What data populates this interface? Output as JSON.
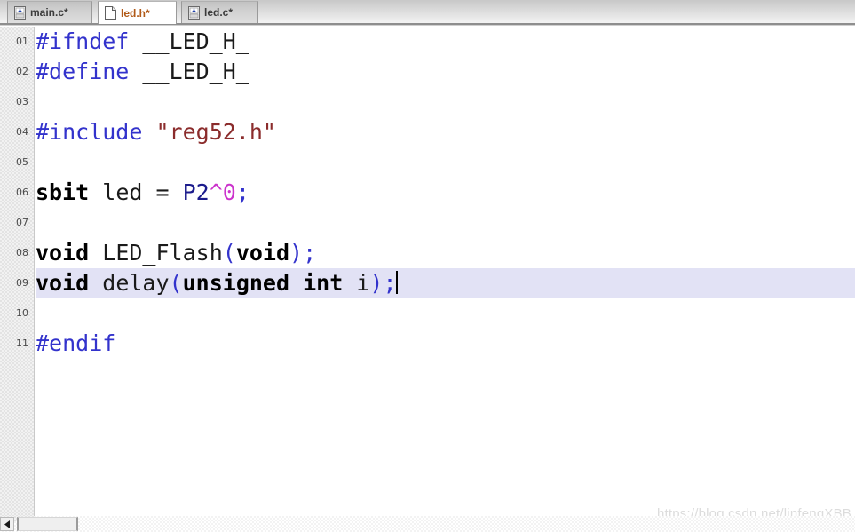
{
  "tabs": [
    {
      "label": "main.c*",
      "icon": "c-source-file-icon",
      "active": false
    },
    {
      "label": "led.h*",
      "icon": "header-file-icon",
      "active": true
    },
    {
      "label": "led.c*",
      "icon": "c-source-file-icon",
      "active": false
    }
  ],
  "editor": {
    "active_file": "led.h*",
    "cursor_line": 9,
    "highlight_color": "#e2e2f5",
    "line_numbers": [
      "01",
      "02",
      "03",
      "04",
      "05",
      "06",
      "07",
      "08",
      "09",
      "10",
      "11"
    ],
    "lines": [
      {
        "n": "01",
        "text": "#ifndef __LED_H_"
      },
      {
        "n": "02",
        "text": "#define __LED_H_"
      },
      {
        "n": "03",
        "text": ""
      },
      {
        "n": "04",
        "text": "#include \"reg52.h\""
      },
      {
        "n": "05",
        "text": ""
      },
      {
        "n": "06",
        "text": "sbit led = P2^0;"
      },
      {
        "n": "07",
        "text": ""
      },
      {
        "n": "08",
        "text": "void LED_Flash(void);"
      },
      {
        "n": "09",
        "text": "void delay(unsigned int i);"
      },
      {
        "n": "10",
        "text": ""
      },
      {
        "n": "11",
        "text": "#endif"
      }
    ],
    "tokens": {
      "l01": {
        "pre": "#ifndef",
        "macro": "__LED_H_"
      },
      "l02": {
        "pre": "#define",
        "macro": "__LED_H_"
      },
      "l04": {
        "pre": "#include",
        "str": "\"reg52.h\""
      },
      "l06": {
        "kw": "sbit",
        "ident": "led",
        "op": "=",
        "sfr": "P2",
        "caret": "^",
        "num": "0",
        "semi": ";"
      },
      "l08": {
        "kw": "void",
        "ident": "LED_Flash",
        "open": "(",
        "kw2": "void",
        "close": ")",
        "semi": ";"
      },
      "l09": {
        "kw": "void",
        "ident": "delay",
        "open": "(",
        "kw2": "unsigned",
        "kw3": "int",
        "ident2": "i",
        "close": ")",
        "semi": ";"
      },
      "l11": {
        "pre": "#endif"
      }
    },
    "colors": {
      "preprocessor": "#3333cc",
      "keyword": "#000000",
      "string": "#8b2c2c",
      "punctuation": "#3333cc",
      "sfr": "#1b1b8c",
      "number": "#cc33cc",
      "identifier": "#1a1a1a",
      "tab_active_text": "#b15a18"
    }
  },
  "watermark": {
    "text": "https://blog.csdn.net/linfengXBB"
  },
  "scrollbar": {
    "left_arrow": "◄",
    "orientation": "horizontal"
  }
}
